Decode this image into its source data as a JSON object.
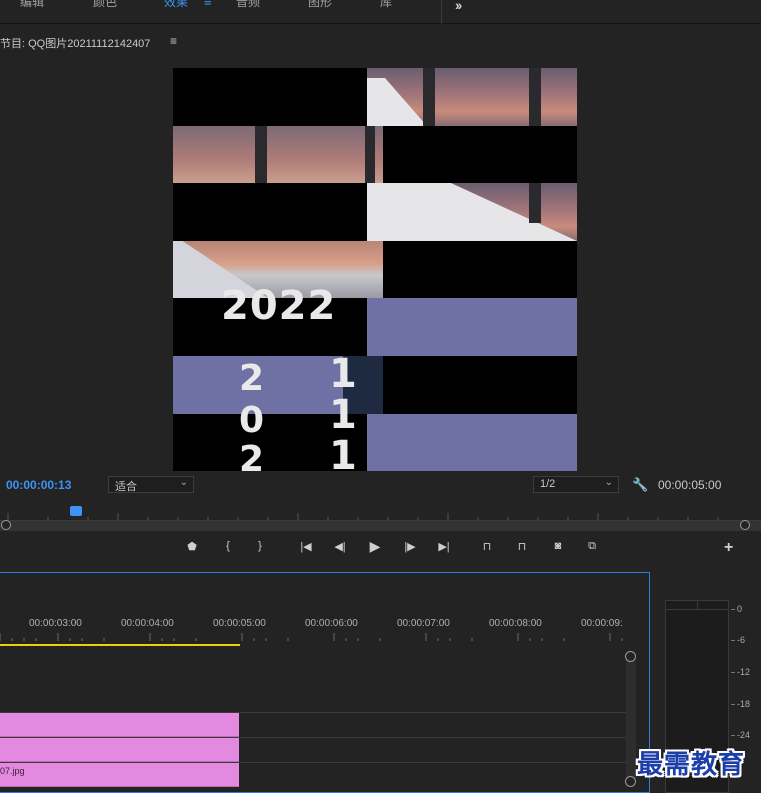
{
  "workspace": {
    "tabs": [
      {
        "label": "编辑"
      },
      {
        "label": "颜色"
      },
      {
        "label": "效果"
      },
      {
        "label": "音频"
      },
      {
        "label": "图形"
      },
      {
        "label": "库"
      }
    ],
    "active_tab": "效果",
    "more_icon": "double-chevron-right-icon",
    "menu_icon": "hamburger-icon"
  },
  "program_monitor": {
    "title": "节目: QQ图片20211112142407",
    "menu_glyph": "≡",
    "frame_text": {
      "year": "2022",
      "digits_left": [
        "2",
        "0",
        "2"
      ],
      "digits_right": [
        "1",
        "1",
        "1"
      ]
    },
    "current_timecode": "00:00:00:13",
    "zoom_select": "适合",
    "resolution_select": "1/2",
    "duration_timecode": "00:00:05:00",
    "settings_icon": "wrench-icon"
  },
  "transport": {
    "buttons": [
      {
        "name": "add-marker-button",
        "icon": "marker-icon",
        "glyph": "⬟"
      },
      {
        "name": "mark-in-button",
        "icon": "mark-in-icon",
        "glyph": "{"
      },
      {
        "name": "mark-out-button",
        "icon": "mark-out-icon",
        "glyph": "}"
      },
      {
        "name": "go-to-in-button",
        "icon": "go-to-in-icon",
        "glyph": "|◀"
      },
      {
        "name": "step-back-button",
        "icon": "step-back-icon",
        "glyph": "◀|"
      },
      {
        "name": "play-button",
        "icon": "play-icon",
        "glyph": "▶"
      },
      {
        "name": "step-forward-button",
        "icon": "step-forward-icon",
        "glyph": "|▶"
      },
      {
        "name": "go-to-out-button",
        "icon": "go-to-out-icon",
        "glyph": "▶|"
      },
      {
        "name": "lift-button",
        "icon": "lift-icon",
        "glyph": "⊓"
      },
      {
        "name": "extract-button",
        "icon": "extract-icon",
        "glyph": "⊓"
      },
      {
        "name": "export-frame-button",
        "icon": "camera-icon",
        "glyph": "◙"
      },
      {
        "name": "compare-view-button",
        "icon": "compare-icon",
        "glyph": "⧉"
      }
    ],
    "add_button_glyph": "+"
  },
  "timeline": {
    "ruler_times": [
      "00:00:03:00",
      "00:00:04:00",
      "00:00:05:00",
      "00:00:06:00",
      "00:00:07:00",
      "00:00:08:00",
      "00:00:09:"
    ],
    "clip_label": "07.jpg"
  },
  "audio_meter": {
    "labels": [
      "0",
      "-6",
      "-12",
      "-18",
      "-24"
    ]
  },
  "watermark": "最需教育",
  "colors": {
    "accent": "#3c94f5",
    "clip": "#e38ae0",
    "in_out_bar": "#e8d400",
    "lavender": "#6f70a3"
  }
}
